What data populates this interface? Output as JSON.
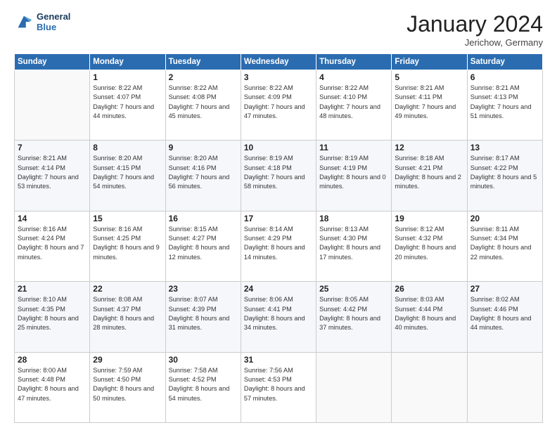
{
  "header": {
    "logo_line1": "General",
    "logo_line2": "Blue",
    "month_title": "January 2024",
    "location": "Jerichow, Germany"
  },
  "weekdays": [
    "Sunday",
    "Monday",
    "Tuesday",
    "Wednesday",
    "Thursday",
    "Friday",
    "Saturday"
  ],
  "weeks": [
    [
      {
        "day": "",
        "sunrise": "",
        "sunset": "",
        "daylight": ""
      },
      {
        "day": "1",
        "sunrise": "Sunrise: 8:22 AM",
        "sunset": "Sunset: 4:07 PM",
        "daylight": "Daylight: 7 hours and 44 minutes."
      },
      {
        "day": "2",
        "sunrise": "Sunrise: 8:22 AM",
        "sunset": "Sunset: 4:08 PM",
        "daylight": "Daylight: 7 hours and 45 minutes."
      },
      {
        "day": "3",
        "sunrise": "Sunrise: 8:22 AM",
        "sunset": "Sunset: 4:09 PM",
        "daylight": "Daylight: 7 hours and 47 minutes."
      },
      {
        "day": "4",
        "sunrise": "Sunrise: 8:22 AM",
        "sunset": "Sunset: 4:10 PM",
        "daylight": "Daylight: 7 hours and 48 minutes."
      },
      {
        "day": "5",
        "sunrise": "Sunrise: 8:21 AM",
        "sunset": "Sunset: 4:11 PM",
        "daylight": "Daylight: 7 hours and 49 minutes."
      },
      {
        "day": "6",
        "sunrise": "Sunrise: 8:21 AM",
        "sunset": "Sunset: 4:13 PM",
        "daylight": "Daylight: 7 hours and 51 minutes."
      }
    ],
    [
      {
        "day": "7",
        "sunrise": "Sunrise: 8:21 AM",
        "sunset": "Sunset: 4:14 PM",
        "daylight": "Daylight: 7 hours and 53 minutes."
      },
      {
        "day": "8",
        "sunrise": "Sunrise: 8:20 AM",
        "sunset": "Sunset: 4:15 PM",
        "daylight": "Daylight: 7 hours and 54 minutes."
      },
      {
        "day": "9",
        "sunrise": "Sunrise: 8:20 AM",
        "sunset": "Sunset: 4:16 PM",
        "daylight": "Daylight: 7 hours and 56 minutes."
      },
      {
        "day": "10",
        "sunrise": "Sunrise: 8:19 AM",
        "sunset": "Sunset: 4:18 PM",
        "daylight": "Daylight: 7 hours and 58 minutes."
      },
      {
        "day": "11",
        "sunrise": "Sunrise: 8:19 AM",
        "sunset": "Sunset: 4:19 PM",
        "daylight": "Daylight: 8 hours and 0 minutes."
      },
      {
        "day": "12",
        "sunrise": "Sunrise: 8:18 AM",
        "sunset": "Sunset: 4:21 PM",
        "daylight": "Daylight: 8 hours and 2 minutes."
      },
      {
        "day": "13",
        "sunrise": "Sunrise: 8:17 AM",
        "sunset": "Sunset: 4:22 PM",
        "daylight": "Daylight: 8 hours and 5 minutes."
      }
    ],
    [
      {
        "day": "14",
        "sunrise": "Sunrise: 8:16 AM",
        "sunset": "Sunset: 4:24 PM",
        "daylight": "Daylight: 8 hours and 7 minutes."
      },
      {
        "day": "15",
        "sunrise": "Sunrise: 8:16 AM",
        "sunset": "Sunset: 4:25 PM",
        "daylight": "Daylight: 8 hours and 9 minutes."
      },
      {
        "day": "16",
        "sunrise": "Sunrise: 8:15 AM",
        "sunset": "Sunset: 4:27 PM",
        "daylight": "Daylight: 8 hours and 12 minutes."
      },
      {
        "day": "17",
        "sunrise": "Sunrise: 8:14 AM",
        "sunset": "Sunset: 4:29 PM",
        "daylight": "Daylight: 8 hours and 14 minutes."
      },
      {
        "day": "18",
        "sunrise": "Sunrise: 8:13 AM",
        "sunset": "Sunset: 4:30 PM",
        "daylight": "Daylight: 8 hours and 17 minutes."
      },
      {
        "day": "19",
        "sunrise": "Sunrise: 8:12 AM",
        "sunset": "Sunset: 4:32 PM",
        "daylight": "Daylight: 8 hours and 20 minutes."
      },
      {
        "day": "20",
        "sunrise": "Sunrise: 8:11 AM",
        "sunset": "Sunset: 4:34 PM",
        "daylight": "Daylight: 8 hours and 22 minutes."
      }
    ],
    [
      {
        "day": "21",
        "sunrise": "Sunrise: 8:10 AM",
        "sunset": "Sunset: 4:35 PM",
        "daylight": "Daylight: 8 hours and 25 minutes."
      },
      {
        "day": "22",
        "sunrise": "Sunrise: 8:08 AM",
        "sunset": "Sunset: 4:37 PM",
        "daylight": "Daylight: 8 hours and 28 minutes."
      },
      {
        "day": "23",
        "sunrise": "Sunrise: 8:07 AM",
        "sunset": "Sunset: 4:39 PM",
        "daylight": "Daylight: 8 hours and 31 minutes."
      },
      {
        "day": "24",
        "sunrise": "Sunrise: 8:06 AM",
        "sunset": "Sunset: 4:41 PM",
        "daylight": "Daylight: 8 hours and 34 minutes."
      },
      {
        "day": "25",
        "sunrise": "Sunrise: 8:05 AM",
        "sunset": "Sunset: 4:42 PM",
        "daylight": "Daylight: 8 hours and 37 minutes."
      },
      {
        "day": "26",
        "sunrise": "Sunrise: 8:03 AM",
        "sunset": "Sunset: 4:44 PM",
        "daylight": "Daylight: 8 hours and 40 minutes."
      },
      {
        "day": "27",
        "sunrise": "Sunrise: 8:02 AM",
        "sunset": "Sunset: 4:46 PM",
        "daylight": "Daylight: 8 hours and 44 minutes."
      }
    ],
    [
      {
        "day": "28",
        "sunrise": "Sunrise: 8:00 AM",
        "sunset": "Sunset: 4:48 PM",
        "daylight": "Daylight: 8 hours and 47 minutes."
      },
      {
        "day": "29",
        "sunrise": "Sunrise: 7:59 AM",
        "sunset": "Sunset: 4:50 PM",
        "daylight": "Daylight: 8 hours and 50 minutes."
      },
      {
        "day": "30",
        "sunrise": "Sunrise: 7:58 AM",
        "sunset": "Sunset: 4:52 PM",
        "daylight": "Daylight: 8 hours and 54 minutes."
      },
      {
        "day": "31",
        "sunrise": "Sunrise: 7:56 AM",
        "sunset": "Sunset: 4:53 PM",
        "daylight": "Daylight: 8 hours and 57 minutes."
      },
      {
        "day": "",
        "sunrise": "",
        "sunset": "",
        "daylight": ""
      },
      {
        "day": "",
        "sunrise": "",
        "sunset": "",
        "daylight": ""
      },
      {
        "day": "",
        "sunrise": "",
        "sunset": "",
        "daylight": ""
      }
    ]
  ]
}
